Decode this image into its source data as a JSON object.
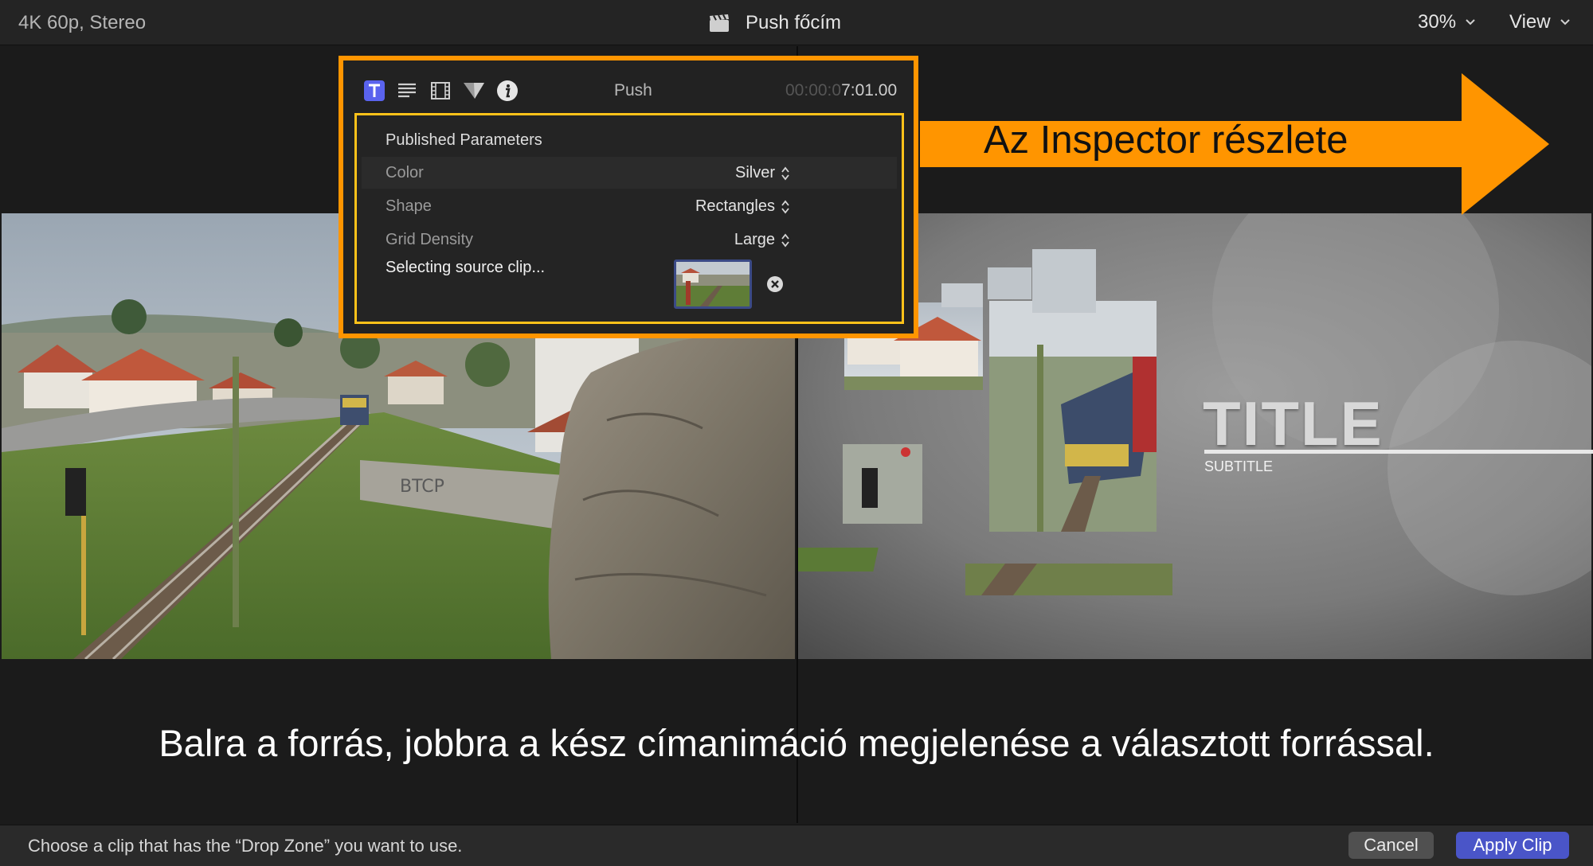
{
  "topbar": {
    "format": "4K 60p, Stereo",
    "title": "Push főcím",
    "zoom": "30%",
    "view": "View"
  },
  "inspector": {
    "tabs": [
      "text-tab",
      "paragraph-tab",
      "video-tab",
      "filter-tab",
      "info-tab"
    ],
    "clip_name": "Push",
    "timecode_dim": "00:00:0",
    "timecode": "7:01.00",
    "section": "Published Parameters",
    "params": [
      {
        "label": "Color",
        "value": "Silver"
      },
      {
        "label": "Shape",
        "value": "Rectangles"
      },
      {
        "label": "Grid Density",
        "value": "Large"
      }
    ],
    "source_label": "Selecting source clip..."
  },
  "annotation": {
    "arrow_text": "Az Inspector részlete",
    "arrow_color": "#ff9500",
    "caption": "Balra a forrás, jobbra a kész címanimáció megjelenése a választott forrással."
  },
  "preview": {
    "title": "TITLE",
    "subtitle": "SUBTITLE"
  },
  "bottombar": {
    "hint": "Choose a clip that has the “Drop Zone” you want to use.",
    "cancel": "Cancel",
    "apply": "Apply Clip"
  },
  "colors": {
    "accent": "#4a55c8",
    "highlight": "#ffc21a"
  }
}
